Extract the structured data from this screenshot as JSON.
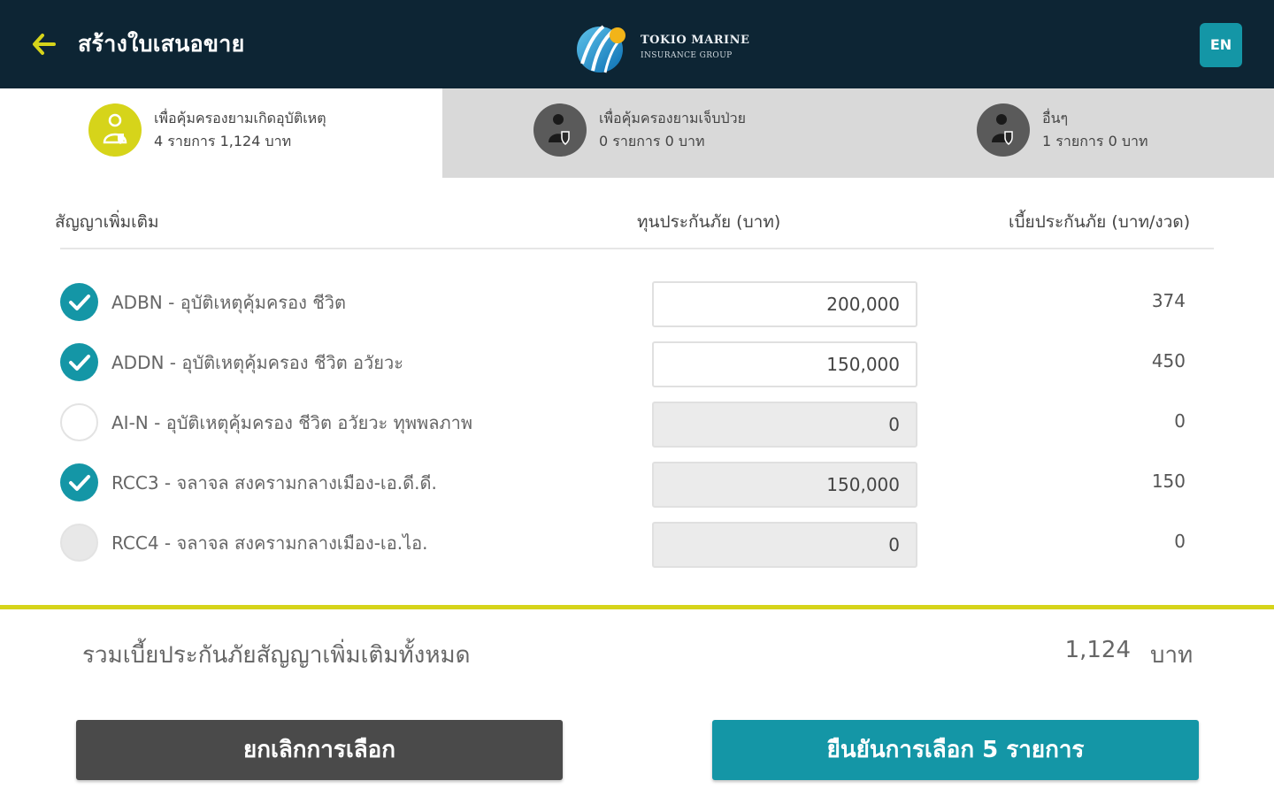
{
  "header": {
    "title": "สร้างใบเสนอขาย",
    "back_icon": "arrow-left-icon",
    "logo_line1": "TOKIO MARINE",
    "logo_line2": "INSURANCE GROUP",
    "lang_label": "EN"
  },
  "tabs": [
    {
      "line1": "เพื่อคุ้มครองยามเกิดอุบัติเหตุ",
      "line2": "4 รายการ 1,124 บาท",
      "icon": "person-shield-icon",
      "active": true
    },
    {
      "line1": "เพื่อคุ้มครองยามเจ็บป่วย",
      "line2": "0 รายการ 0 บาท",
      "icon": "person-shield-icon",
      "active": false
    },
    {
      "line1": "อื่นๆ",
      "line2": "1 รายการ 0 บาท",
      "icon": "person-shield-icon",
      "active": false
    }
  ],
  "table": {
    "headers": {
      "rider": "สัญญาเพิ่มเติม",
      "sum_assured": "ทุนประกันภัย (บาท)",
      "premium": "เบี้ยประกันภัย (บาท/งวด)"
    },
    "rows": [
      {
        "label": "ADBN - อุบัติเหตุคุ้มครอง ชีวิต",
        "checked": true,
        "amount": "200,000",
        "editable": true,
        "premium": "374"
      },
      {
        "label": "ADDN - อุบัติเหตุคุ้มครอง ชีวิต อวัยวะ",
        "checked": true,
        "amount": "150,000",
        "editable": true,
        "premium": "450"
      },
      {
        "label": "AI-N - อุบัติเหตุคุ้มครอง ชีวิต อวัยวะ ทุพพลภาพ",
        "checked": false,
        "amount": "0",
        "editable": false,
        "premium": "0"
      },
      {
        "label": "RCC3 - จลาจล สงครามกลางเมือง-เอ.ดี.ดี.",
        "checked": true,
        "amount": "150,000",
        "editable": false,
        "premium": "150"
      },
      {
        "label": "RCC4 - จลาจล สงครามกลางเมือง-เอ.ไอ.",
        "checked": false,
        "amount": "0",
        "editable": false,
        "premium": "0"
      }
    ]
  },
  "total": {
    "label": "รวมเบี้ยประกันภัยสัญญาเพิ่มเติมทั้งหมด",
    "value": "1,124",
    "unit": "บาท"
  },
  "buttons": {
    "cancel_label": "ยกเลิกการเลือก",
    "confirm_label": "ยืนยันการเลือก  5 รายการ"
  },
  "colors": {
    "header_bg": "#0d2534",
    "accent_teal": "#1496a6",
    "accent_yellow": "#d6d41a",
    "cancel_bg": "#4a4a4a"
  }
}
